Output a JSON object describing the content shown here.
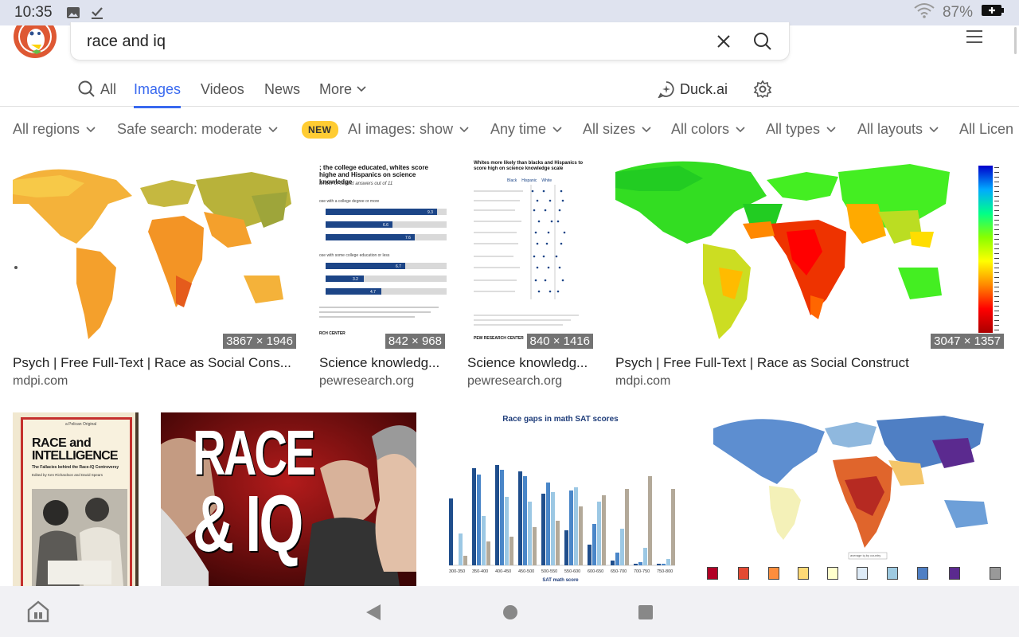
{
  "status": {
    "time": "10:35",
    "battery": "87%"
  },
  "search": {
    "query": "race and iq"
  },
  "tabs": [
    {
      "label": "All"
    },
    {
      "label": "Images"
    },
    {
      "label": "Videos"
    },
    {
      "label": "News"
    },
    {
      "label": "More"
    }
  ],
  "duckai": "Duck.ai",
  "filters": {
    "regions": "All regions",
    "safe": "Safe search: moderate",
    "new_badge": "NEW",
    "ai": "AI images: show",
    "time": "Any time",
    "sizes": "All sizes",
    "colors": "All colors",
    "types": "All types",
    "layouts": "All layouts",
    "licenses": "All Licen"
  },
  "results_row1": [
    {
      "dims": "3867 × 1946",
      "title": "Psych | Free Full-Text | Race as Social Cons...",
      "source": "mdpi.com"
    },
    {
      "dims": "842 × 968",
      "title": "Science knowledg...",
      "source": "pewresearch.org"
    },
    {
      "dims": "840 × 1416",
      "title": "Science knowledg...",
      "source": "pewresearch.org"
    },
    {
      "dims": "3047 × 1357",
      "title": "Psych | Free Full-Text | Race as Social Construct",
      "source": "mdpi.com"
    }
  ],
  "thumb_text": {
    "pew1_title": "; the college educated, whites score highe and Hispanics on science knowledge",
    "pew1_sub": "umber of correct answers out of 11",
    "pew1_group1": "ose with a college degree or more",
    "pew1_group2": "ose with some college education or less",
    "pew1_values": [
      "9.3",
      "6.6",
      "7.6",
      "6.7",
      "3.2",
      "4.7"
    ],
    "pew1_footer": "RCH CENTER",
    "pew2_title": "Whites more likely than blacks and Hispanics to score high on science knowledge scale",
    "pew2_legend": [
      "Black",
      "Hispanic",
      "White"
    ],
    "pew2_footer": "PEW RESEARCH CENTER",
    "book_publisher": "a Pelican Original",
    "book_title1": "RACE and",
    "book_title2": "INTELLIGENCE",
    "book_subtitle": "The Fallacies behind the Race-IQ Controversy",
    "book_editors": "Edited by Ken Richardson and David Spears",
    "video_line1": "RACE",
    "video_line2": "& IQ",
    "sat_title": "Race gaps in math SAT scores",
    "sat_xlabel": "SAT math score",
    "sat_categories": [
      "300-350",
      "350-400",
      "400-450",
      "450-500",
      "500-550",
      "550-600",
      "600-650",
      "650-700",
      "700-750",
      "750-800"
    ],
    "map_legend": "average iq by country"
  },
  "nav": {
    "home": "home-icon",
    "back": "back-icon",
    "homebtn": "circle-icon",
    "recents": "square-icon"
  }
}
